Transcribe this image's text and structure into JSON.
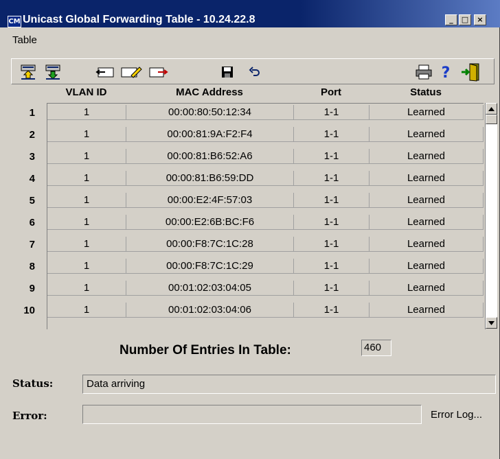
{
  "window": {
    "icon_text": "CM",
    "title": "Unicast Global Forwarding Table - 10.24.22.8",
    "minimize": "_",
    "maximize": "□",
    "close": "×"
  },
  "menu": {
    "items": [
      "Table"
    ]
  },
  "toolbar": {
    "buttons": [
      "upload-icon",
      "download-icon",
      "insert-row-icon",
      "edit-row-icon",
      "export-row-icon",
      "save-icon",
      "undo-icon",
      "print-icon",
      "help-icon",
      "exit-icon"
    ]
  },
  "table": {
    "headers": [
      "VLAN ID",
      "MAC Address",
      "Port",
      "Status"
    ],
    "rows": [
      {
        "num": "1",
        "vlan": "1",
        "mac": "00:00:80:50:12:34",
        "port": "1-1",
        "status": "Learned"
      },
      {
        "num": "2",
        "vlan": "1",
        "mac": "00:00:81:9A:F2:F4",
        "port": "1-1",
        "status": "Learned"
      },
      {
        "num": "3",
        "vlan": "1",
        "mac": "00:00:81:B6:52:A6",
        "port": "1-1",
        "status": "Learned"
      },
      {
        "num": "4",
        "vlan": "1",
        "mac": "00:00:81:B6:59:DD",
        "port": "1-1",
        "status": "Learned"
      },
      {
        "num": "5",
        "vlan": "1",
        "mac": "00:00:E2:4F:57:03",
        "port": "1-1",
        "status": "Learned"
      },
      {
        "num": "6",
        "vlan": "1",
        "mac": "00:00:E2:6B:BC:F6",
        "port": "1-1",
        "status": "Learned"
      },
      {
        "num": "7",
        "vlan": "1",
        "mac": "00:00:F8:7C:1C:28",
        "port": "1-1",
        "status": "Learned"
      },
      {
        "num": "8",
        "vlan": "1",
        "mac": "00:00:F8:7C:1C:29",
        "port": "1-1",
        "status": "Learned"
      },
      {
        "num": "9",
        "vlan": "1",
        "mac": "00:01:02:03:04:05",
        "port": "1-1",
        "status": "Learned"
      },
      {
        "num": "10",
        "vlan": "1",
        "mac": "00:01:02:03:04:06",
        "port": "1-1",
        "status": "Learned"
      }
    ]
  },
  "summary": {
    "entries_label": "Number Of Entries In Table:",
    "entries_value": "460"
  },
  "status": {
    "label": "Status:",
    "value": "Data arriving"
  },
  "error": {
    "label": "Error:",
    "value": "",
    "log_link": "Error Log..."
  },
  "colors": {
    "title_bar": "#0a246a",
    "window_bg": "#d4d0c8"
  }
}
